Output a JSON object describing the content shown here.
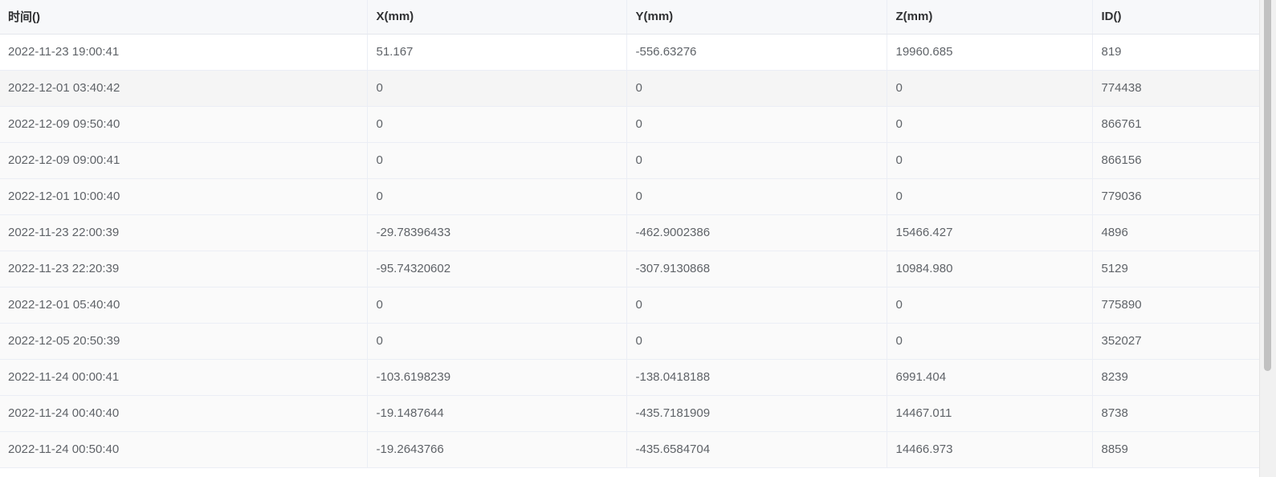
{
  "table": {
    "columns": [
      "时间()",
      "X(mm)",
      "Y(mm)",
      "Z(mm)",
      "ID()"
    ],
    "rows": [
      [
        "2022-11-23 19:00:41",
        "51.167",
        "-556.63276",
        "19960.685",
        "819"
      ],
      [
        "2022-12-01 03:40:42",
        "0",
        "0",
        "0",
        "774438"
      ],
      [
        "2022-12-09 09:50:40",
        "0",
        "0",
        "0",
        "866761"
      ],
      [
        "2022-12-09 09:00:41",
        "0",
        "0",
        "0",
        "866156"
      ],
      [
        "2022-12-01 10:00:40",
        "0",
        "0",
        "0",
        "779036"
      ],
      [
        "2022-11-23 22:00:39",
        "-29.78396433",
        "-462.9002386",
        "15466.427",
        "4896"
      ],
      [
        "2022-11-23 22:20:39",
        "-95.74320602",
        "-307.9130868",
        "10984.980",
        "5129"
      ],
      [
        "2022-12-01 05:40:40",
        "0",
        "0",
        "0",
        "775890"
      ],
      [
        "2022-12-05 20:50:39",
        "0",
        "0",
        "0",
        "352027"
      ],
      [
        "2022-11-24 00:00:41",
        "-103.6198239",
        "-138.0418188",
        "6991.404",
        "8239"
      ],
      [
        "2022-11-24 00:40:40",
        "-19.1487644",
        "-435.7181909",
        "14467.011",
        "8738"
      ],
      [
        "2022-11-24 00:50:40",
        "-19.2643766",
        "-435.6584704",
        "14466.973",
        "8859"
      ]
    ]
  }
}
